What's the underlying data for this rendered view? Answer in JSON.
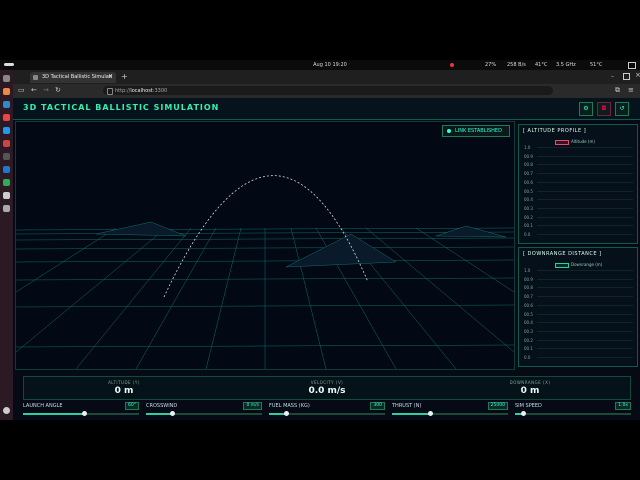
{
  "system": {
    "clock": "Aug 10  19:20",
    "cpu": "27%",
    "mem": "258 B/s",
    "temp1": "41°C",
    "freq": "3.5 GHz",
    "temp2": "51°C"
  },
  "browser": {
    "tab_title": "3D Tactical Ballistic Simulati",
    "url_scheme": "http://",
    "url_host": "localhost",
    "url_port": ":3300"
  },
  "app": {
    "title": "3D TACTICAL BALLISTIC SIMULATION",
    "link_status": "LINK ESTABLISHED",
    "colors": {
      "accent": "#34f0b0",
      "trajectory": "#cfd8dc",
      "grid": "#0e6f6a"
    }
  },
  "altitude_panel": {
    "title": "[ ALTITUDE PROFILE ]",
    "legend": "Altitude (m)",
    "legend_color": "#e0506e",
    "yticks": [
      "1.0",
      "00.9",
      "00.8",
      "00.7",
      "00.6",
      "00.5",
      "00.4",
      "00.3",
      "00.2",
      "00.1",
      "0.0"
    ]
  },
  "downrange_panel": {
    "title": "[ DOWNRANGE DISTANCE ]",
    "legend": "Downrange (m)",
    "legend_color": "#2fd0a0",
    "yticks": [
      "1.0",
      "00.9",
      "00.8",
      "00.7",
      "00.6",
      "00.5",
      "00.4",
      "00.3",
      "00.2",
      "00.1",
      "0.0"
    ]
  },
  "readouts": [
    {
      "label": "ALTITUDE (Y)",
      "value": "0 m"
    },
    {
      "label": "VELOCITY (V)",
      "value": "0.0 m/s"
    },
    {
      "label": "DOWNRANGE (X)",
      "value": "0 m"
    }
  ],
  "controls": [
    {
      "label": "LAUNCH ANGLE",
      "value": "60°",
      "level": 0.53
    },
    {
      "label": "CROSSWIND",
      "value": "0 m/s",
      "level": 0.22
    },
    {
      "label": "FUEL MASS (KG)",
      "value": "300",
      "level": 0.15
    },
    {
      "label": "THRUST (N)",
      "value": "25000",
      "level": 0.33
    },
    {
      "label": "SIM SPEED",
      "value": "1.0x",
      "level": 0.07
    }
  ]
}
